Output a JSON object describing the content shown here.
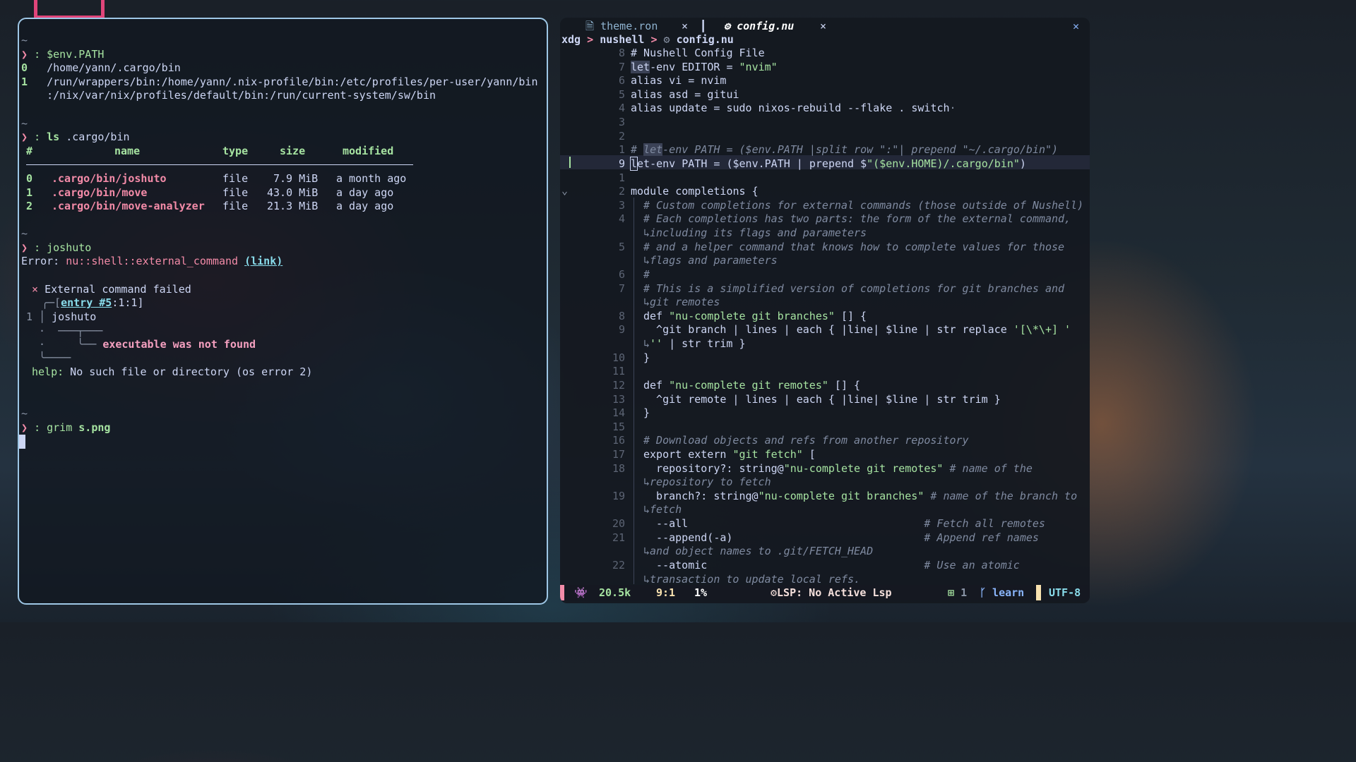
{
  "terminal": {
    "lines": {
      "l1": "~",
      "l2_cmd": ": $env.PATH",
      "l3_idx": "0",
      "l3_val": "/home/yann/.cargo/bin",
      "l4_idx": "1",
      "l4_val": "/run/wrappers/bin:/home/yann/.nix-profile/bin:/etc/profiles/per-user/yann/bin",
      "l5_val": ":/nix/var/nix/profiles/default/bin:/run/current-system/sw/bin",
      "l6": "~",
      "l7_cmd_a": ": ",
      "l7_cmd_b": "ls",
      "l7_cmd_c": " .cargo/bin",
      "table_headers": {
        "idx": "#",
        "name": "name",
        "type": "type",
        "size": "size",
        "modified": "modified"
      },
      "rows": [
        {
          "idx": "0",
          "name": ".cargo/bin/joshuto",
          "type": "file",
          "size": "7.9 MiB",
          "modified": "a month ago"
        },
        {
          "idx": "1",
          "name": ".cargo/bin/move",
          "type": "file",
          "size": "43.0 MiB",
          "modified": "a day ago"
        },
        {
          "idx": "2",
          "name": ".cargo/bin/move-analyzer",
          "type": "file",
          "size": "21.3 MiB",
          "modified": "a day ago"
        }
      ],
      "l8": "~",
      "l9_cmd": ": joshuto",
      "err_label": "Error: ",
      "err_code": "nu::shell::external_command",
      "err_link": "(link)",
      "fail_x": "×",
      "fail_msg": "External command failed",
      "entry_open": "╭─[",
      "entry_ref": "entry #5",
      "entry_pos": ":1:1]",
      "src_num": "1",
      "src_text": "joshuto",
      "exec_msg": "executable was not found",
      "help_label": "help:",
      "help_msg": " No such file or directory (os error 2)",
      "l10": "~",
      "l11_cmd_a": ": grim ",
      "l11_cmd_b": "s.png",
      "prompt_glyph": "❯"
    }
  },
  "editor": {
    "tabs": [
      {
        "label": "theme.ron",
        "close": "×"
      },
      {
        "label": "config.nu",
        "close": "×"
      }
    ],
    "window_close": "✕",
    "breadcrumb": {
      "a": "xdg",
      "sep": ">",
      "b": "nushell",
      "sep2": ">",
      "c": "config.nu"
    },
    "lines": [
      {
        "n": "8",
        "t": "# Nushell Config File"
      },
      {
        "n": "7",
        "a": "let",
        "t": "-env EDITOR = ",
        "s": "\"nvim\""
      },
      {
        "n": "6",
        "t": "alias vi = nvim"
      },
      {
        "n": "5",
        "t": "alias asd = gitui"
      },
      {
        "n": "4",
        "t": "alias update = sudo nixos-rebuild --flake . switch",
        "dot": "·"
      },
      {
        "n": "3",
        "t": ""
      },
      {
        "n": "2",
        "t": ""
      },
      {
        "n": "1",
        "c": "# ",
        "h": "let",
        "c2": "-env PATH = ($env.PATH |split row \":\"| prepend \"~/.cargo/bin\")"
      },
      {
        "n": "9",
        "cur": "l",
        "t": "et-env PATH = ($env.PATH | prepend $",
        "s": "\"($env.HOME)/.cargo/bin\"",
        "t2": ")"
      },
      {
        "n": "1",
        "t": ""
      },
      {
        "n": "2",
        "t": "module completions {"
      },
      {
        "n": "3",
        "c": "# Custom completions for external commands (those outside of Nushell)"
      },
      {
        "n": "4",
        "c": "# Each completions has two parts: the form of the external command,"
      },
      {
        "n": "",
        "c": "↳including its flags and parameters"
      },
      {
        "n": "5",
        "c": "# and a helper command that knows how to complete values for those"
      },
      {
        "n": "",
        "c": "↳flags and parameters"
      },
      {
        "n": "6",
        "c": "#"
      },
      {
        "n": "7",
        "c": "# This is a simplified version of completions for git branches and"
      },
      {
        "n": "",
        "c": "↳git remotes"
      },
      {
        "n": "8",
        "t": "def ",
        "s": "\"nu-complete git branches\"",
        "t2": " [] {"
      },
      {
        "n": "9",
        "t": "  ^git branch | lines | each { |line| $line | str replace ",
        "s": "'[\\*\\+] '"
      },
      {
        "n": "",
        "c": "↳",
        "s2": "''",
        "t3": " | str trim }"
      },
      {
        "n": "10",
        "t": "}"
      },
      {
        "n": "11",
        "t": ""
      },
      {
        "n": "12",
        "t": "def ",
        "s": "\"nu-complete git remotes\"",
        "t2": " [] {"
      },
      {
        "n": "13",
        "t": "  ^git remote | lines | each { |line| $line | str trim }"
      },
      {
        "n": "14",
        "t": "}"
      },
      {
        "n": "15",
        "t": ""
      },
      {
        "n": "16",
        "c": "# Download objects and refs from another repository"
      },
      {
        "n": "17",
        "t": "export extern ",
        "s": "\"git fetch\"",
        "t2": " ["
      },
      {
        "n": "18",
        "t": "  repository?: string@",
        "s": "\"nu-complete git remotes\"",
        "c3": " # name of the"
      },
      {
        "n": "",
        "c": "↳repository to fetch"
      },
      {
        "n": "19",
        "t": "  branch?: string@",
        "s": "\"nu-complete git branches\"",
        "c3": " # name of the branch to"
      },
      {
        "n": "",
        "c": "↳fetch"
      },
      {
        "n": "20",
        "t": "  --all",
        "c3": "                                     # Fetch all remotes"
      },
      {
        "n": "21",
        "t": "  --append(-a)",
        "c3": "                              # Append ref names"
      },
      {
        "n": "",
        "c": "↳and object names to .git/FETCH_HEAD"
      },
      {
        "n": "22",
        "t": "  --atomic",
        "c3": "                                  # Use an atomic"
      },
      {
        "n": "",
        "c": "↳transaction to update local refs."
      }
    ],
    "status": {
      "mode_icon": "👾",
      "size": "20.5k",
      "pos": "9:1",
      "percent": "1%",
      "lsp": "LSP: No Active Lsp",
      "git_added": "1",
      "branch": "learn",
      "encoding": "UTF-8"
    }
  }
}
